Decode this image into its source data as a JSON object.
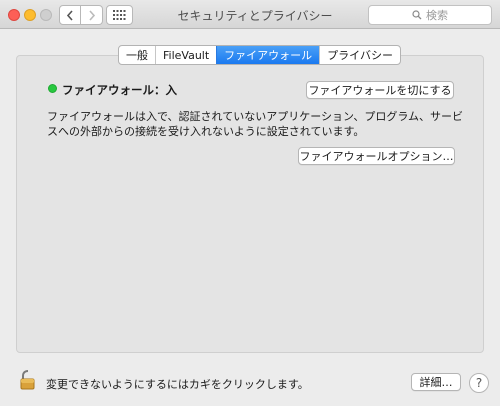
{
  "window": {
    "title": "セキュリティとプライバシー",
    "search_placeholder": "検索"
  },
  "tabs": [
    {
      "label": "一般",
      "active": false
    },
    {
      "label": "FileVault",
      "active": false
    },
    {
      "label": "ファイアウォール",
      "active": true
    },
    {
      "label": "プライバシー",
      "active": false
    }
  ],
  "firewall": {
    "status_label": "ファイアウォール：入",
    "status_color": "#28c840",
    "turn_off_button": "ファイアウォールを切にする",
    "description": "ファイアウォールは入で、認証されていないアプリケーション、プログラム、サービスへの外部からの接続を受け入れないように設定されています。",
    "options_button": "ファイアウォールオプション…"
  },
  "footer": {
    "lock_text": "変更できないようにするにはカギをクリックします。",
    "advanced_button": "詳細…",
    "help_label": "?"
  }
}
